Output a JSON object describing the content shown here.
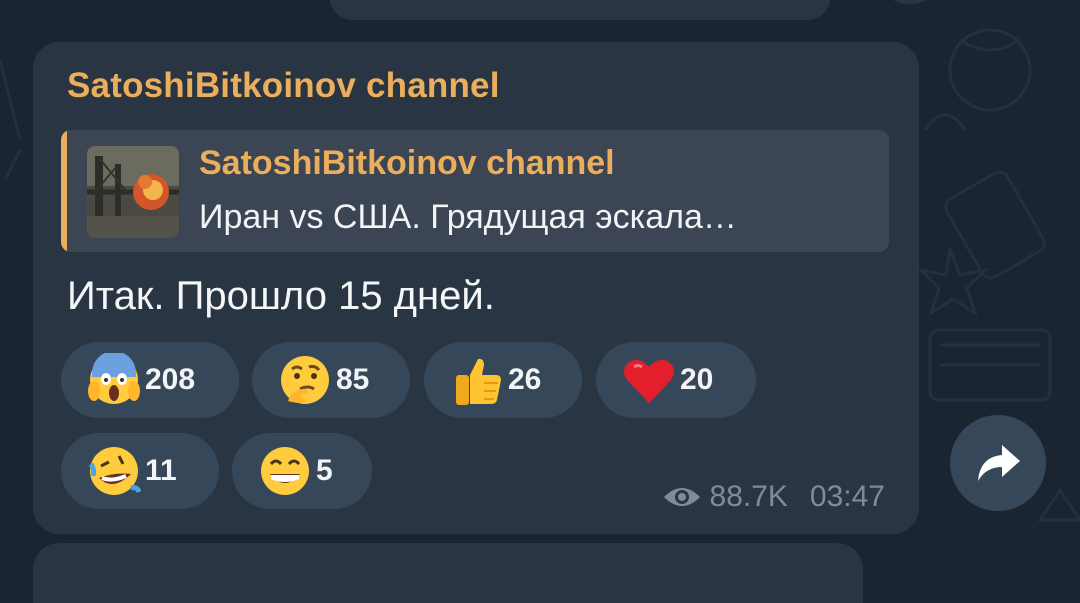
{
  "message": {
    "channel_name": "SatoshiBitkoinov channel",
    "reply": {
      "title": "SatoshiBitkoinov channel",
      "text": "Иран vs США. Грядущая эскала…"
    },
    "text": "Итак. Прошло 15 дней.",
    "reactions": [
      {
        "emoji": "face-screaming-in-fear",
        "count": "208"
      },
      {
        "emoji": "thinking-face",
        "count": "85"
      },
      {
        "emoji": "thumbs-up",
        "count": "26"
      },
      {
        "emoji": "red-heart",
        "count": "20"
      },
      {
        "emoji": "rolling-on-floor-laughing",
        "count": "11"
      },
      {
        "emoji": "grinning-face-with-smiling-eyes",
        "count": "5"
      }
    ],
    "views": "88.7K",
    "time": "03:47"
  },
  "colors": {
    "background": "#1b2431",
    "bubble": "#2a3543",
    "accent": "#eaae5d",
    "reaction_pill": "#37475a",
    "meta_text": "#7f8b99"
  }
}
